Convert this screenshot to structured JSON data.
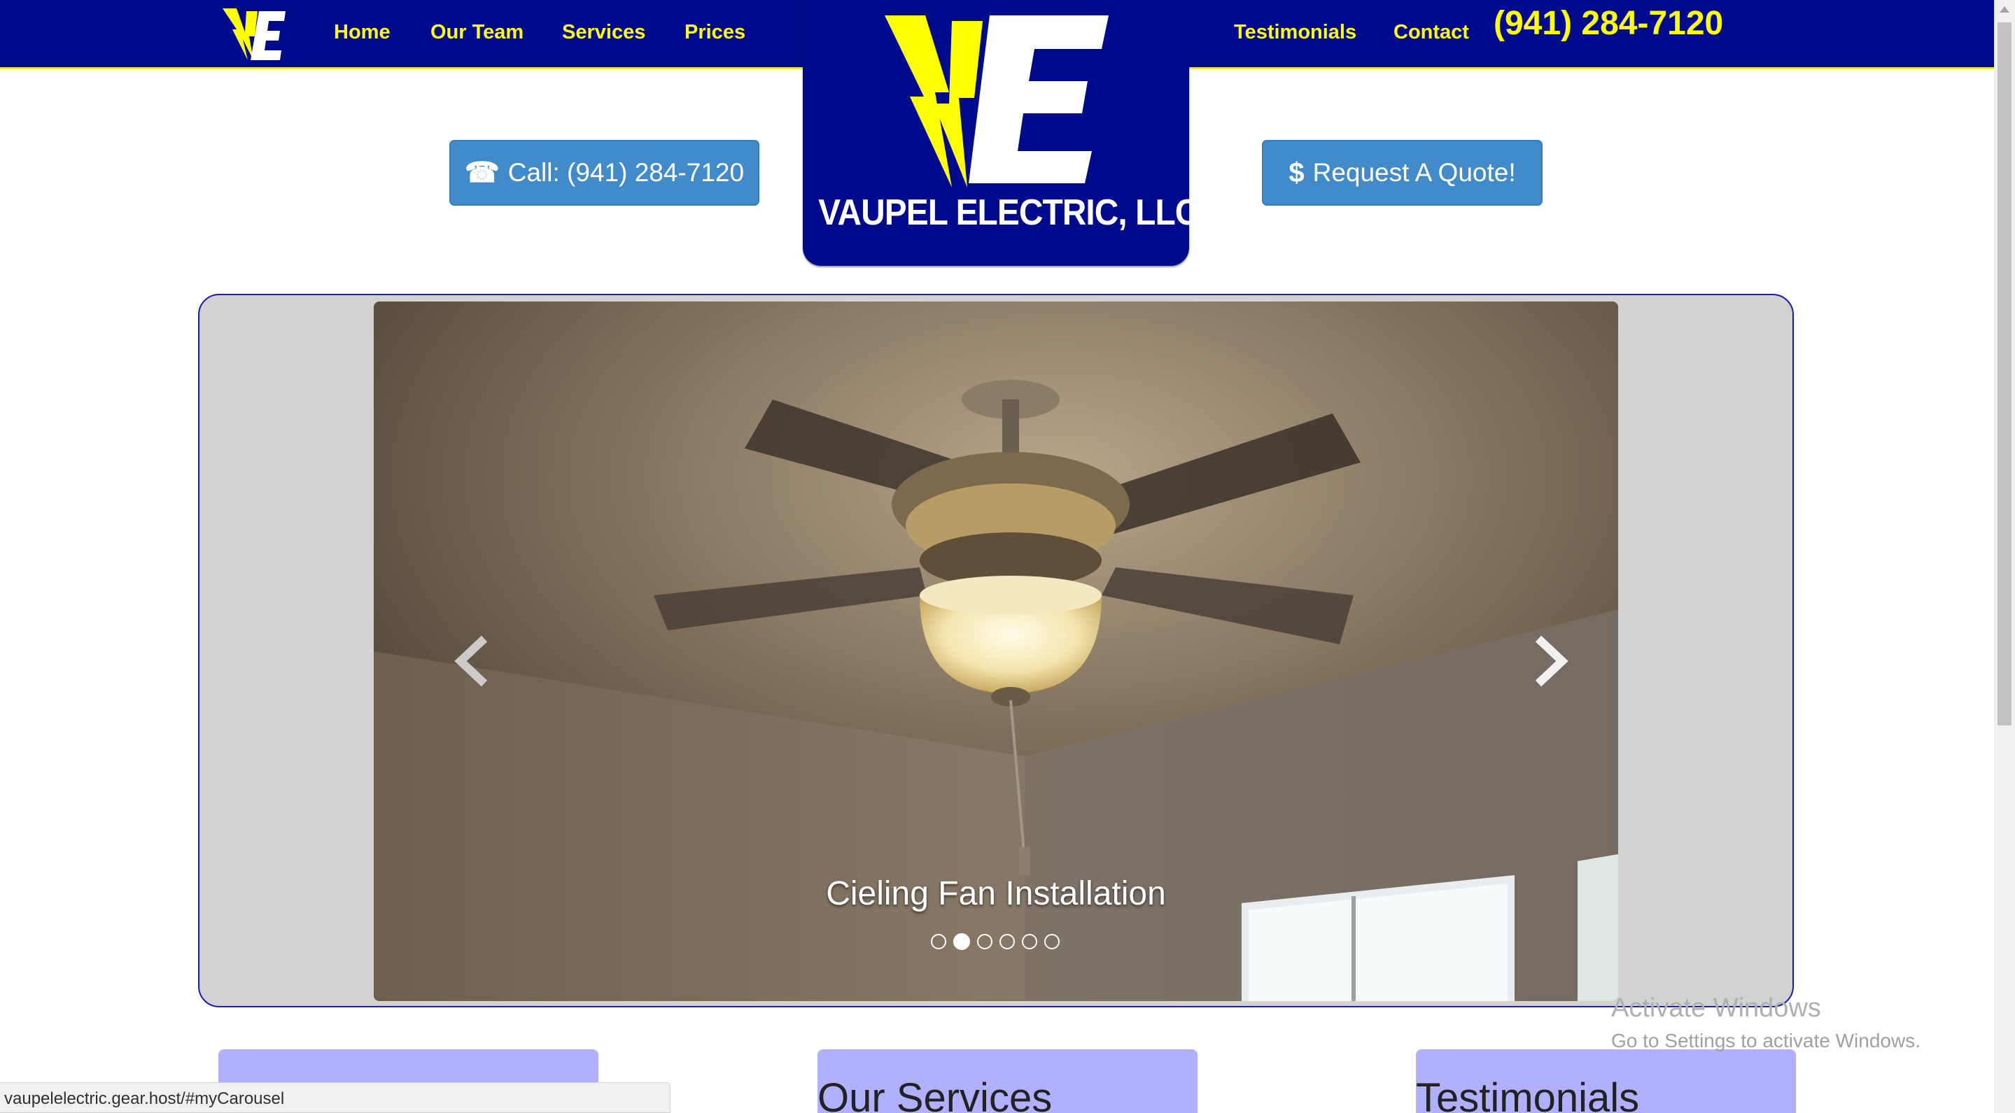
{
  "nav": {
    "links": [
      "Home",
      "Our Team",
      "Services",
      "Prices",
      "Testimonials",
      "Contact"
    ],
    "phone": "(941) 284-7120"
  },
  "logo": {
    "company": "VAUPEL ELECTRIC, LLC",
    "monogram": "VE"
  },
  "buttons": {
    "call": {
      "icon": "phone-icon",
      "label": "Call: (941) 284-7120"
    },
    "quote": {
      "icon": "dollar-icon",
      "label": "Request A Quote!"
    }
  },
  "carousel": {
    "caption": "Cieling Fan Installation",
    "slide_count": 6,
    "active_index": 1,
    "prev_icon": "chevron-left-icon",
    "next_icon": "chevron-right-icon"
  },
  "sections": {
    "col1_title": "",
    "col2_title": "Our Services",
    "col3_title": "Testimonials"
  },
  "watermark": {
    "title": "Activate Windows",
    "subtitle": "Go to Settings to activate Windows."
  },
  "status_bar": {
    "url": "vaupelelectric.gear.host/#myCarousel"
  },
  "colors": {
    "navy": "#000a8c",
    "yellow": "#ffff00",
    "button_blue": "#428bca",
    "section_lavender": "#b0b0ff"
  }
}
